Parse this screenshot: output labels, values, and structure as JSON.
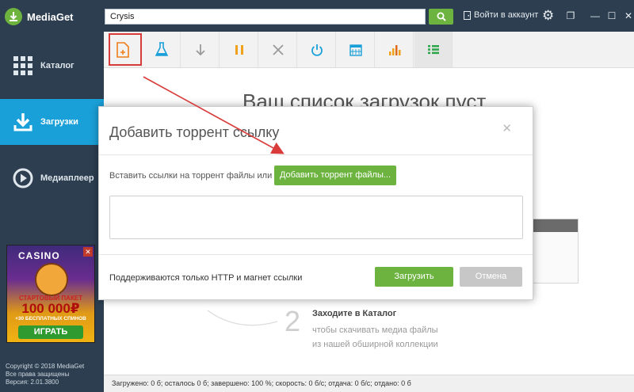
{
  "app": {
    "name": "MediaGet",
    "brand_color": "#6cb33f",
    "sidebar_color": "#2c3e50",
    "active_color": "#1aa0d8"
  },
  "search": {
    "value": "Crysis"
  },
  "header": {
    "login_label": "Войти в аккаунт"
  },
  "window_controls": {
    "close": "✕",
    "minimize": "—",
    "maximize": "☐",
    "restore": "❐"
  },
  "sidebar": {
    "items": [
      {
        "label": "Каталог",
        "icon": "grid-icon"
      },
      {
        "label": "Загрузки",
        "icon": "download-icon"
      },
      {
        "label": "Медиаплеер",
        "icon": "play-icon"
      }
    ],
    "footer": [
      "Copyright © 2018 MediaGet",
      "Все права защищены",
      "Версия: 2.01.3800"
    ]
  },
  "ad": {
    "logo": "CASINO",
    "line1": "СТАРТОВЫЙ ПАКЕТ",
    "line2": "100 000₽",
    "line3": "+30 БЕСПЛАТНЫХ СПИНОВ",
    "button": "ИГРАТЬ"
  },
  "toolbar": {
    "buttons": [
      "add-torrent-icon",
      "flask-icon",
      "download-arrow-icon",
      "pause-icon",
      "cancel-icon",
      "power-icon",
      "calendar-icon",
      "bar-chart-icon",
      "list-icon"
    ]
  },
  "main": {
    "empty_title": "Ваш список загрузок пуст",
    "step_number": "2",
    "step_title": "Заходите в Каталог",
    "step_text_1": "чтобы скачивать медиа файлы",
    "step_text_2": "из нашей обширной коллекции"
  },
  "dialog": {
    "title": "Добавить торрент ссылку",
    "close": "✕",
    "paste_label": "Вставить ссылки на торрент файлы или",
    "add_files_button": "Добавить торрент файлы...",
    "textarea_value": "",
    "support_text": "Поддерживаются только HTTP и магнет ссылки",
    "load_button": "Загрузить",
    "cancel_button": "Отмена"
  },
  "status": {
    "text": "Загружено: 0 б; осталось 0 б; завершено: 100 %; скорость: 0 б/с; отдача: 0 б/с; отдано: 0 б"
  }
}
